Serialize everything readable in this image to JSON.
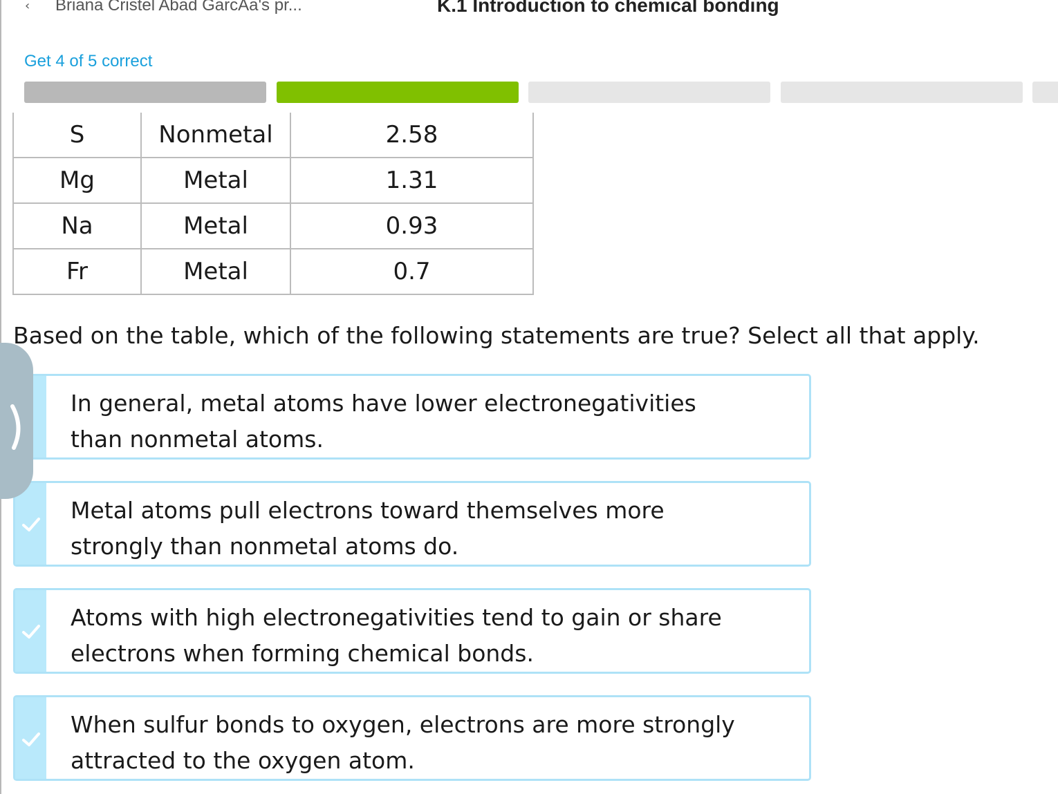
{
  "header": {
    "breadcrumb": "Briana Cristel Abad GarcÃa's pr...",
    "title": "K.1 Introduction to chemical bonding"
  },
  "goal_text": "Get 4 of 5 correct",
  "progress": {
    "segments": [
      "completed",
      "correct",
      "empty",
      "empty",
      "empty"
    ]
  },
  "table": {
    "rows": [
      [
        "S",
        "Nonmetal",
        "2.58"
      ],
      [
        "Mg",
        "Metal",
        "1.31"
      ],
      [
        "Na",
        "Metal",
        "0.93"
      ],
      [
        "Fr",
        "Metal",
        "0.7"
      ]
    ]
  },
  "question": "Based on the table, which of the following statements are true? Select all that apply.",
  "choices": [
    {
      "line1": "In general, metal atoms have lower electronegativities",
      "line2": "than nonmetal atoms."
    },
    {
      "line1": "Metal atoms pull electrons toward themselves more",
      "line2": "strongly than nonmetal atoms do."
    },
    {
      "line1": "Atoms with high electronegativities tend to gain or share",
      "line2": "electrons when forming chemical bonds."
    },
    {
      "line1": "When sulfur bonds to oxygen, electrons are more strongly",
      "line2": "attracted to the oxygen atom."
    }
  ],
  "colors": {
    "accent_blue": "#1aa0dc",
    "progress_green": "#80c000",
    "choice_border": "#aee2f7"
  },
  "icons": [
    "back-chevron-icon",
    "side-next-chevron-icon",
    "check-icon"
  ]
}
